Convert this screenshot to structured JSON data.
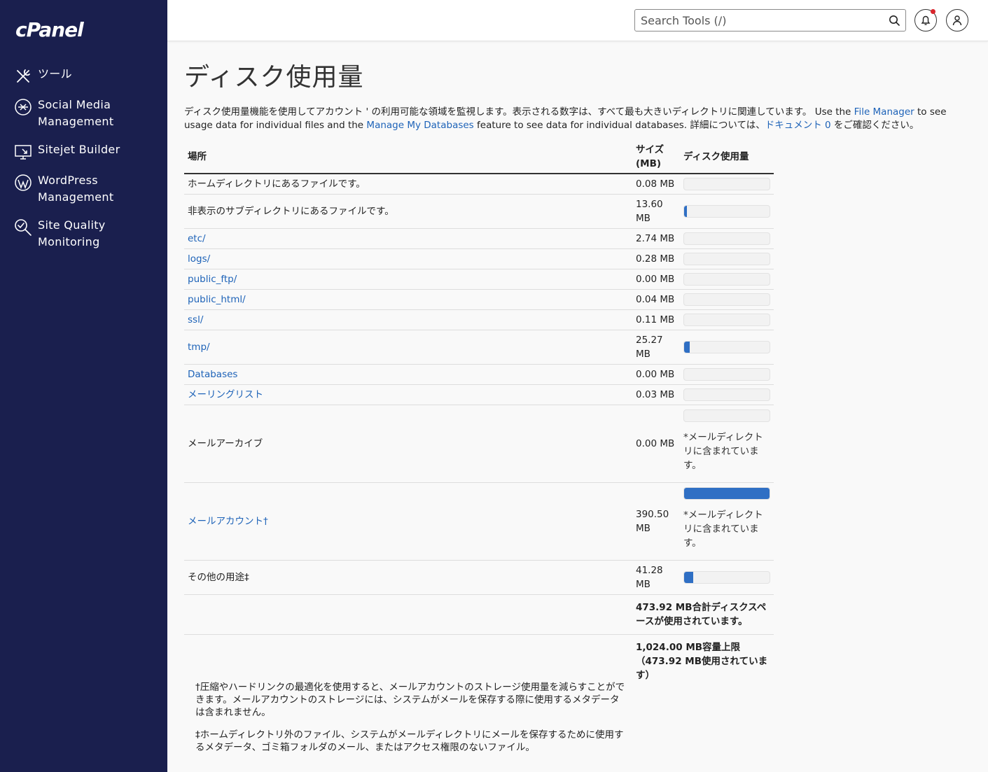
{
  "sidebar": {
    "logo": "cPanel",
    "items": [
      {
        "label": "ツール"
      },
      {
        "label": "Social Media Management"
      },
      {
        "label": "Sitejet Builder"
      },
      {
        "label": "WordPress Management"
      },
      {
        "label": "Site Quality Monitoring"
      }
    ]
  },
  "header": {
    "search_placeholder": "Search Tools (/)"
  },
  "main": {
    "title": "ディスク使用量",
    "intro": {
      "part1": "ディスク使用量機能を使用してアカウント ' の利用可能な領域を監視します。表示される数字は、すべて最も大きいディレクトリに関連しています。 Use the ",
      "file_manager": "File Manager",
      "part2": " to see usage data for individual files and the ",
      "manage_db": "Manage My Databases",
      "part3": " feature to see data for individual databases. 詳細については、",
      "doc_link": "ドキュメント 0",
      "part4": " をご確認ください。"
    },
    "table": {
      "headers": {
        "location": "場所",
        "size": "サイズ (MB)",
        "usage": "ディスク使用量"
      },
      "rows": [
        {
          "location": "ホームディレクトリにあるファイルです。",
          "link": false,
          "size": "0.08 MB",
          "pct": 0
        },
        {
          "location": "非表示のサブディレクトリにあるファイルです。",
          "link": false,
          "size": "13.60 MB",
          "pct": 3.5
        },
        {
          "location": "etc/",
          "link": true,
          "size": "2.74 MB",
          "pct": 0
        },
        {
          "location": "logs/",
          "link": true,
          "size": "0.28 MB",
          "pct": 0
        },
        {
          "location": "public_ftp/",
          "link": true,
          "size": "0.00 MB",
          "pct": 0
        },
        {
          "location": "public_html/",
          "link": true,
          "size": "0.04 MB",
          "pct": 0
        },
        {
          "location": "ssl/",
          "link": true,
          "size": "0.11 MB",
          "pct": 0
        },
        {
          "location": "tmp/",
          "link": true,
          "size": "25.27 MB",
          "pct": 6.5
        },
        {
          "location": "Databases",
          "link": true,
          "size": "0.00 MB",
          "pct": 0
        },
        {
          "location": "メーリングリスト",
          "link": true,
          "size": "0.03 MB",
          "pct": 0
        },
        {
          "location": "メールアーカイブ",
          "link": false,
          "size": "0.00 MB",
          "pct": 0,
          "note": "*メールディレクトリに含まれています。"
        },
        {
          "location": "メールアカウント†",
          "link": true,
          "size": "390.50 MB",
          "pct": 100,
          "note": "*メールディレクトリに含まれています。"
        },
        {
          "location": "その他の用途‡",
          "link": false,
          "size": "41.28 MB",
          "pct": 10.6
        }
      ],
      "total_used": "473.92 MB合計ディスクスペースが使用されています。",
      "quota": "1,024.00 MB容量上限（473.92 MB使用されています）"
    },
    "footnotes": [
      "†圧縮やハードリンクの最適化を使用すると、メールアカウントのストレージ使用量を減らすことができます。メールアカウントのストレージには、システムがメールを保存する際に使用するメタデータは含まれません。",
      "‡ホームディレクトリ外のファイル、システムがメールディレクトリにメールを保存するために使用するメタデータ、ゴミ箱フォルダのメール、またはアクセス権限のないファイル。"
    ]
  },
  "colors": {
    "sidebar": "#1a1f4e",
    "accent": "#2f6fc4",
    "link": "#1e63b8",
    "notification": "#d9252c"
  }
}
